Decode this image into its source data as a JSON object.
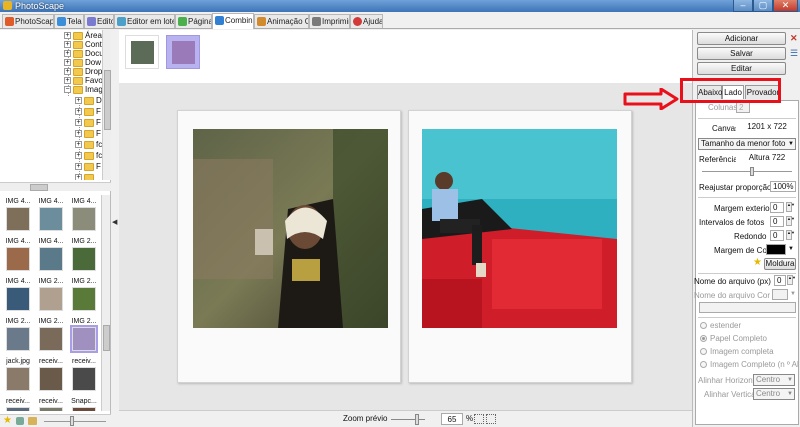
{
  "window": {
    "title": "PhotoScape",
    "min": "‒",
    "max": "▢",
    "close": "✕"
  },
  "tabs": [
    {
      "label": "PhotoScape",
      "color": "#e05a2a",
      "active": false
    },
    {
      "label": "Tela",
      "color": "#3b8fd9",
      "active": false
    },
    {
      "label": "Editor",
      "color": "#7a7ad0",
      "active": false
    },
    {
      "label": "Editor em lotes",
      "color": "#4aa0c8",
      "active": false
    },
    {
      "label": "Página",
      "color": "#4bb04b",
      "active": false
    },
    {
      "label": "Combine",
      "color": "#2f7fd4",
      "active": true
    },
    {
      "label": "Animação Gif",
      "color": "#d28a2e",
      "active": false
    },
    {
      "label": "Imprimir",
      "color": "#7a7a7a",
      "active": false
    },
    {
      "label": "Ajuda",
      "color": "#d23a3a",
      "active": false
    }
  ],
  "tree": {
    "items": [
      {
        "label": "Área",
        "expander": "+"
      },
      {
        "label": "Cont",
        "expander": "+"
      },
      {
        "label": "Docu",
        "expander": "+"
      },
      {
        "label": "Dow",
        "expander": "+"
      },
      {
        "label": "Drop",
        "expander": "+"
      },
      {
        "label": "Favo",
        "expander": "+"
      },
      {
        "label": "Imag",
        "expander": "−"
      },
      {
        "label": "D",
        "expander": "+"
      },
      {
        "label": "F",
        "expander": "+"
      },
      {
        "label": "F",
        "expander": "+"
      },
      {
        "label": "F",
        "expander": "+"
      },
      {
        "label": "fc",
        "expander": "+"
      },
      {
        "label": "fc",
        "expander": "+"
      },
      {
        "label": "F",
        "expander": "+"
      },
      {
        "label": "",
        "expander": "+"
      }
    ]
  },
  "thumbnails": [
    {
      "label": "IMG 4...",
      "color": "#7d6f5a",
      "selected": false
    },
    {
      "label": "IMG 4...",
      "color": "#6b8d9c",
      "selected": false
    },
    {
      "label": "IMG 4...",
      "color": "#8c8c7a",
      "selected": false
    },
    {
      "label": "IMG 4...",
      "color": "#9a6a4a",
      "selected": false
    },
    {
      "label": "IMG 4...",
      "color": "#5a7a8a",
      "selected": false
    },
    {
      "label": "IMG 2...",
      "color": "#4a6a3a",
      "selected": false
    },
    {
      "label": "IMG 4...",
      "color": "#3a5a7a",
      "selected": false
    },
    {
      "label": "IMG 2...",
      "color": "#b0a090",
      "selected": false
    },
    {
      "label": "IMG 2...",
      "color": "#5a7a3a",
      "selected": false
    },
    {
      "label": "IMG 2...",
      "color": "#6a7a8a",
      "selected": false
    },
    {
      "label": "IMG 2...",
      "color": "#7a6a5a",
      "selected": false
    },
    {
      "label": "IMG 2...",
      "color": "#a090c0",
      "selected": true
    },
    {
      "label": "jack.jpg",
      "color": "#8a7a6a",
      "selected": false
    },
    {
      "label": "receiv...",
      "color": "#6a5a4a",
      "selected": false
    },
    {
      "label": "receiv...",
      "color": "#4a4a4a",
      "selected": false
    },
    {
      "label": "receiv...",
      "color": "#5a6a7a",
      "selected": false
    },
    {
      "label": "receiv...",
      "color": "#7a7a6a",
      "selected": false
    },
    {
      "label": "Snapc...",
      "color": "#6a4a3a",
      "selected": false
    }
  ],
  "strip": [
    {
      "color": "#5b6b58",
      "selected": false
    },
    {
      "color": "#9a7ab8",
      "selected": true
    }
  ],
  "status": {
    "zoom_label": "Zoom prévio",
    "zoom_value": "65",
    "zoom_unit": "%",
    "zoom_percent": 65
  },
  "panel": {
    "add_button": "Adicionar",
    "save_button": "Salvar",
    "edit_button": "Editar",
    "tab_below": "Abaixo",
    "tab_side": "Lado",
    "tab_tester": "Provador",
    "columns_label": "Colunas",
    "columns_value": "2",
    "canvas_label": "Canvas",
    "canvas_value": "1201 x 722",
    "size_option": "Tamanho da menor foto",
    "reference_label": "Referência",
    "reference_value": "Altura 722",
    "rescale_label": "Reajustar proporção",
    "rescale_value": "100%",
    "outer_margin_label": "Margem exterior",
    "outer_margin_value": "0",
    "photo_interval_label": "Intervalos de fotos",
    "photo_interval_value": "0",
    "round_label": "Redondo",
    "round_value": "0",
    "margin_color_label": "Margem de Cor",
    "frame_button": "Moldura",
    "filename_label": "Nome do arquivo (px)",
    "filename_value": "0",
    "filename_color_label": "Nome do arquivo Cor",
    "stretch_label": "estender",
    "full_paper_label": "Papel Completo",
    "full_image_label": "Imagem completa",
    "full_image_n_label": "Imagem Completo (n º Alar",
    "align_h_label": "Alinhar Horizontal",
    "align_h_value": "Centro",
    "align_v_label": "Alinhar Vertical",
    "align_v_value": "Centro"
  },
  "colors": {
    "highlight": "#e8101a",
    "selection": "#b9b2f0",
    "margin_color": "#000000"
  }
}
